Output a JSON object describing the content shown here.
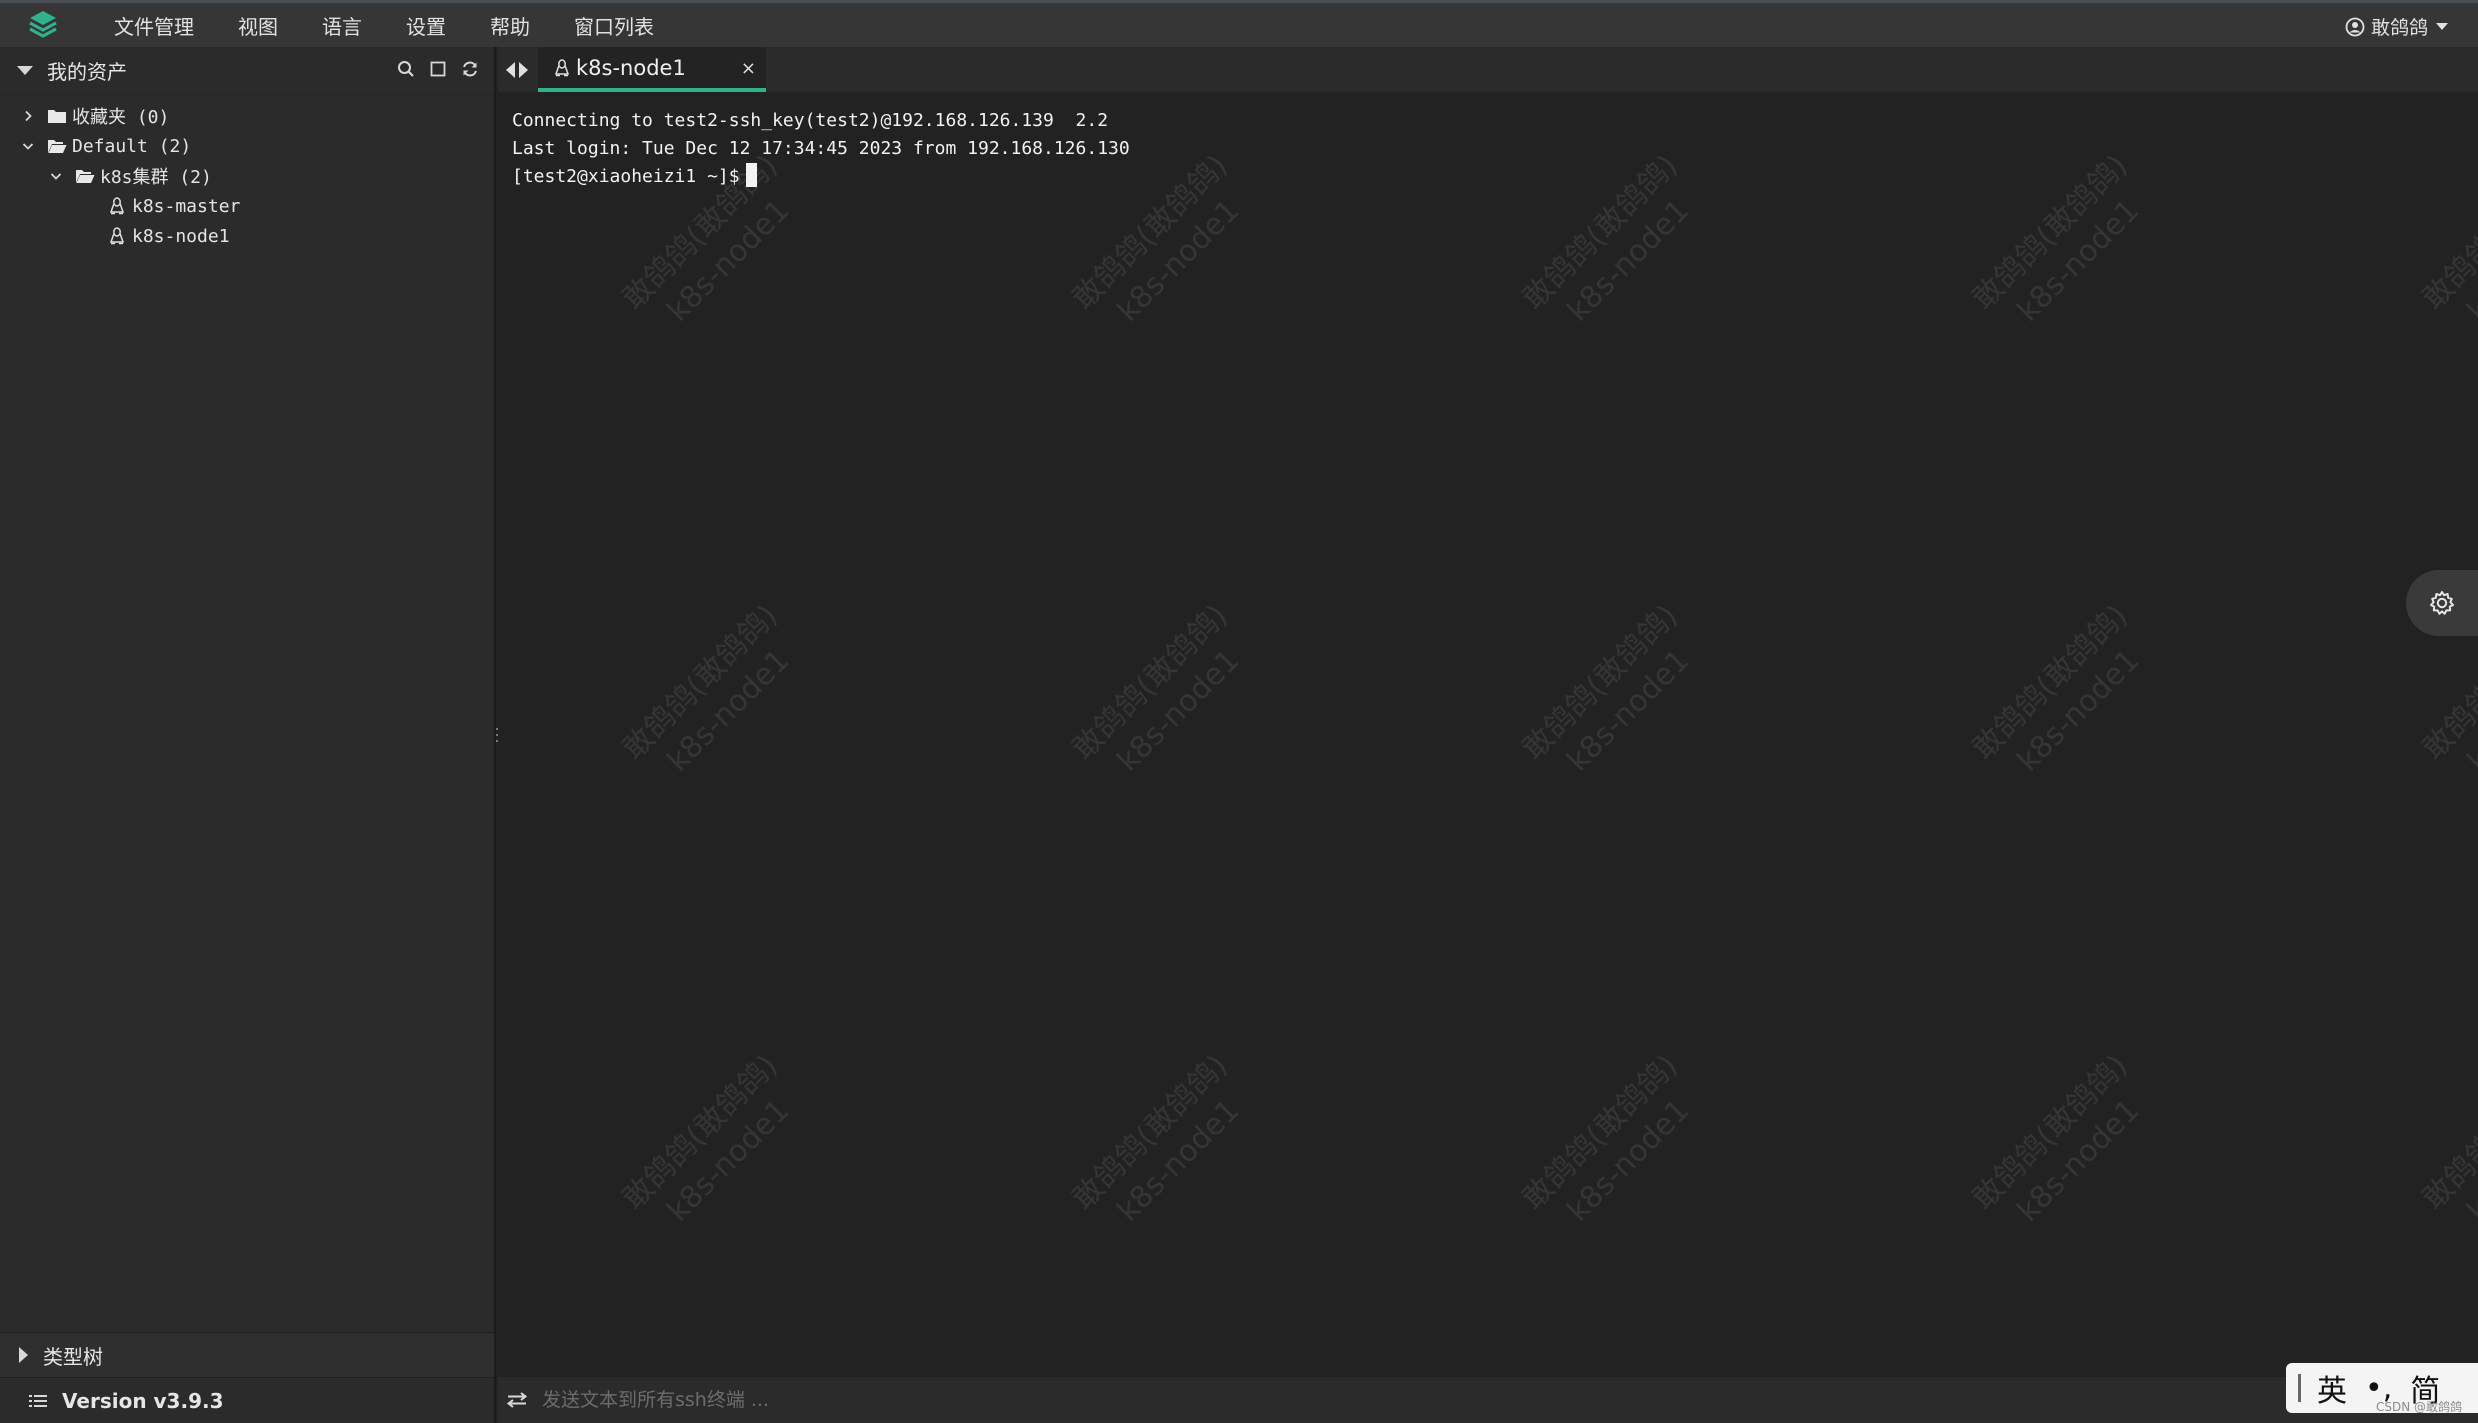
{
  "menubar": {
    "items": [
      "文件管理",
      "视图",
      "语言",
      "设置",
      "帮助",
      "窗口列表"
    ],
    "user_label": "敢鸽鸽"
  },
  "sidebar": {
    "title": "我的资产",
    "tree": [
      {
        "label": "收藏夹 (0)",
        "level": 0,
        "type": "folder",
        "expanded": false
      },
      {
        "label": "Default (2)",
        "level": 0,
        "type": "folder-open",
        "expanded": true
      },
      {
        "label": "k8s集群 (2)",
        "level": 1,
        "type": "folder-open",
        "expanded": true
      },
      {
        "label": "k8s-master",
        "level": 2,
        "type": "linux-host"
      },
      {
        "label": "k8s-node1",
        "level": 2,
        "type": "linux-host"
      }
    ],
    "type_tree_label": "类型树",
    "version_label": "Version v3.9.3"
  },
  "tabs": {
    "active_label": "k8s-node1",
    "close_glyph": "×"
  },
  "terminal": {
    "lines": [
      "Connecting to test2-ssh_key(test2)@192.168.126.139  2.2",
      "Last login: Tue Dec 12 17:34:45 2023 from 192.168.126.130",
      "[test2@xiaoheizi1 ~]$"
    ],
    "watermark_line1": "敢鸽鸽(敢鸽鸽)",
    "watermark_line2": "k8s-node1"
  },
  "sendbar": {
    "placeholder": "发送文本到所有ssh终端 ..."
  },
  "ime": {
    "mode": "英",
    "punct": "•,",
    "script": "简"
  },
  "footer_mark": "CSDN @敢鸽鸽",
  "colors": {
    "accent": "#2fb38d",
    "background": "#222222",
    "sidebar": "#2b2b2b"
  }
}
